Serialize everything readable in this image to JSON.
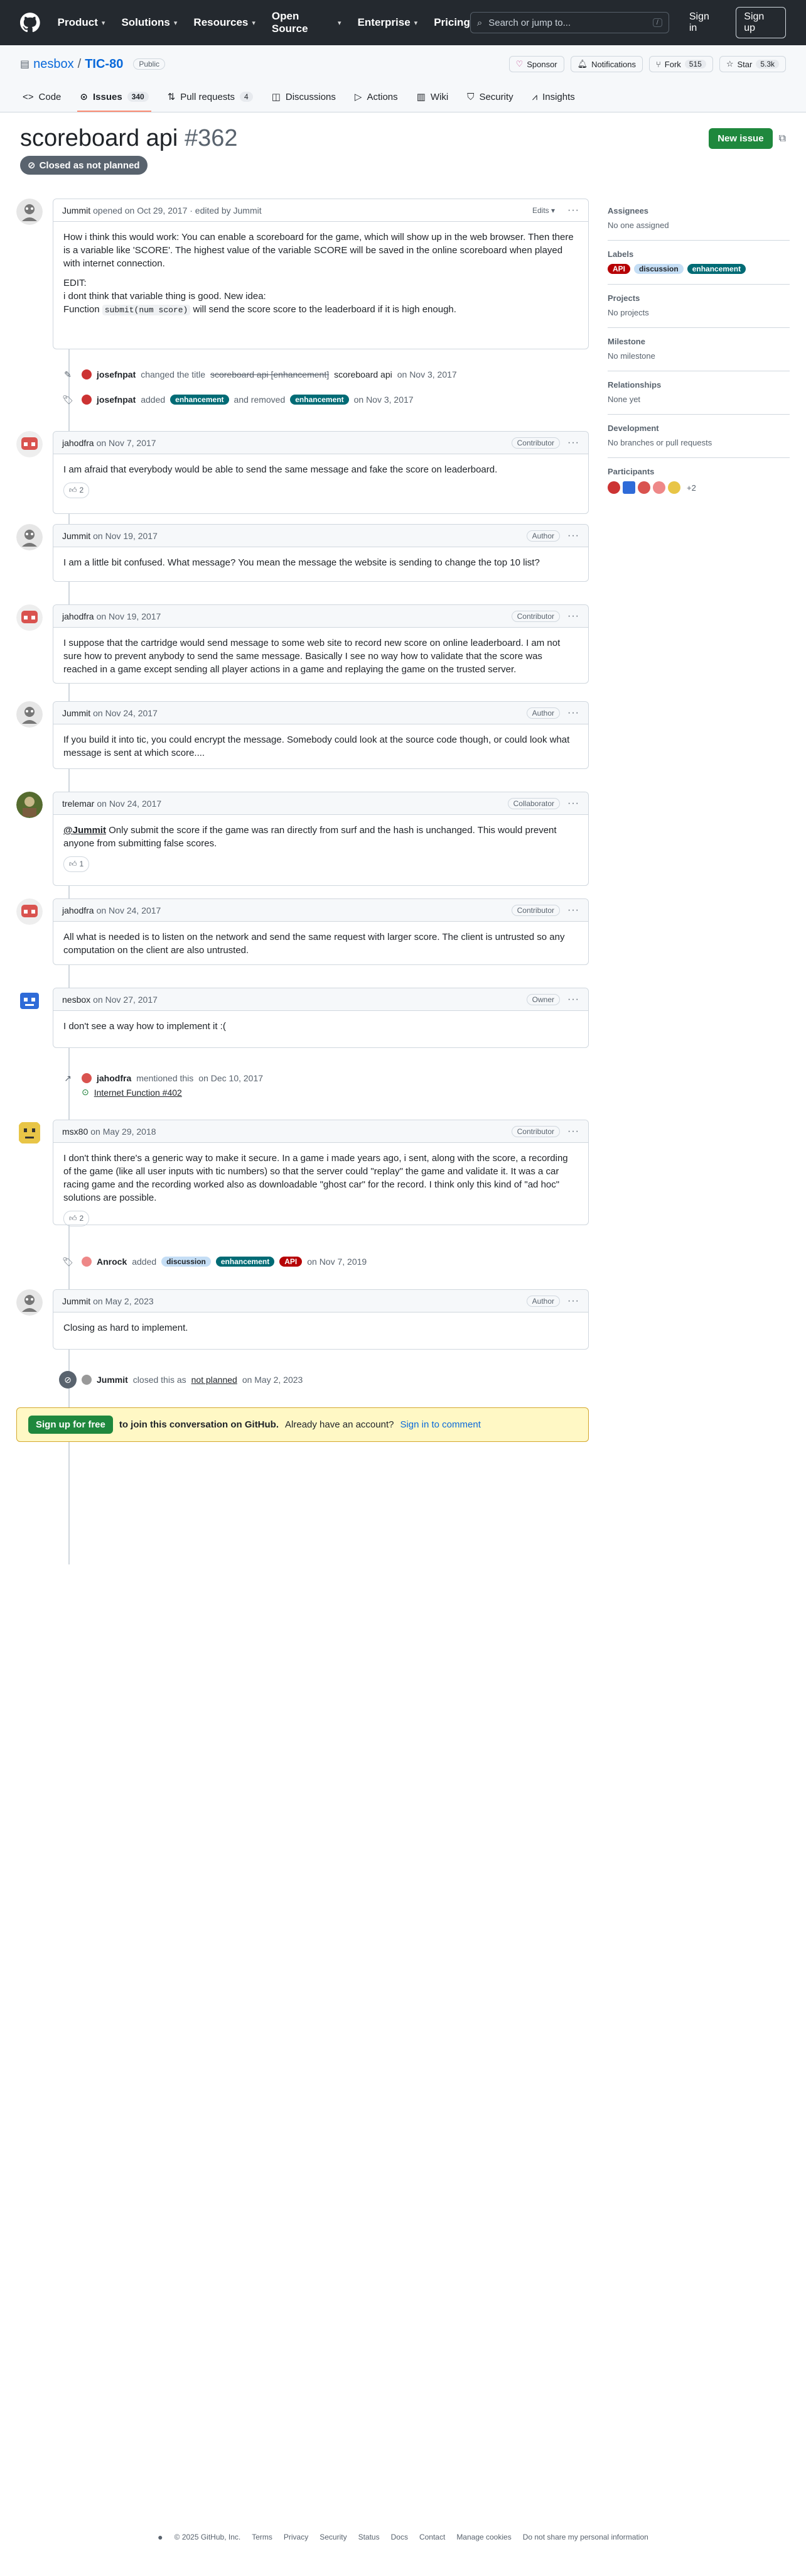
{
  "header": {
    "nav": [
      "Product",
      "Solutions",
      "Resources",
      "Open Source",
      "Enterprise",
      "Pricing"
    ],
    "search_placeholder": "Search or jump to...",
    "search_kbd": "/",
    "signin": "Sign in",
    "signup": "Sign up"
  },
  "repo": {
    "owner": "nesbox",
    "name": "TIC-80",
    "visibility": "Public",
    "sponsor": "Sponsor",
    "notifications": "Notifications",
    "fork_label": "Fork",
    "fork_count": "515",
    "star_label": "Star",
    "star_count": "5.3k",
    "tabs": [
      {
        "label": "Code",
        "count": ""
      },
      {
        "label": "Issues",
        "count": "340"
      },
      {
        "label": "Pull requests",
        "count": "4"
      },
      {
        "label": "Discussions",
        "count": ""
      },
      {
        "label": "Actions",
        "count": ""
      },
      {
        "label": "Wiki",
        "count": ""
      },
      {
        "label": "Security",
        "count": ""
      },
      {
        "label": "Insights",
        "count": ""
      }
    ]
  },
  "issue": {
    "title": "scoreboard api",
    "number": "#362",
    "state": "Closed as not planned",
    "new_issue": "New issue"
  },
  "comments": [
    {
      "author": "Jummit",
      "date_text": "opened on Oct 29, 2017",
      "edited": "· edited by Jummit",
      "edits": "Edits",
      "body": [
        "How i think this would work: You can enable a scoreboard for the game, which will show up in the web browser. Then there is a variable like 'SCORE'. The highest value of the variable SCORE will be saved in the online scoreboard when played with internet connection.",
        "EDIT:",
        "i dont think that variable thing is good. New idea:",
        "Function",
        "submit(num score)",
        "will send the score score to the leaderboard if it is high enough."
      ]
    },
    {
      "author": "jahodfra",
      "date": "on Nov 7, 2017",
      "role": "Contributor",
      "body": "I am afraid that everybody would be able to send the same message and fake the score on leaderboard.",
      "reaction": "2"
    },
    {
      "author": "Jummit",
      "date": "on Nov 19, 2017",
      "role": "Author",
      "body": "I am a little bit confused. What message? You mean the message the website is sending to change the top 10 list?"
    },
    {
      "author": "jahodfra",
      "date": "on Nov 19, 2017",
      "role": "Contributor",
      "body": "I suppose that the cartridge would send message to some web site to record new score on online leaderboard. I am not sure how to prevent anybody to send the same message. Basically I see no way how to validate that the score was reached in a game except sending all player actions in a game and replaying the game on the trusted server."
    },
    {
      "author": "Jummit",
      "date": "on Nov 24, 2017",
      "role": "Author",
      "body": "If you build it into tic, you could encrypt the message. Somebody could look at the source code though, or could look what message is sent at which score...."
    },
    {
      "author": "trelemar",
      "date": "on Nov 24, 2017",
      "role": "Collaborator",
      "mention": "@Jummit",
      "body": "Only submit the score if the game was ran directly from surf and the hash is unchanged. This would prevent anyone from submitting false scores.",
      "reaction": "1"
    },
    {
      "author": "jahodfra",
      "date": "on Nov 24, 2017",
      "role": "Contributor",
      "body": "All what is needed is to listen on the network and send the same request with larger score. The client is untrusted so any computation on the client are also untrusted."
    },
    {
      "author": "nesbox",
      "date": "on Nov 27, 2017",
      "role": "Owner",
      "body": "I don't see a way how to implement it :("
    },
    {
      "author": "msx80",
      "date": "on May 29, 2018",
      "role": "Contributor",
      "body": "I don't think there's a generic way to make it secure. In a game i made years ago, i sent, along with the score, a recording of the game (like all user inputs with tic numbers) so that the server could \"replay\" the game and validate it. It was a car racing game and the recording worked also as downloadable \"ghost car\" for the record. I think only this kind of \"ad hoc\" solutions are possible.",
      "reaction": "2"
    },
    {
      "author": "Jummit",
      "date": "on May 2, 2023",
      "role": "Author",
      "body": "Closing as hard to implement."
    }
  ],
  "events": {
    "rename": {
      "actor": "josefnpat",
      "text1": "changed the title",
      "old": "scoreboard api [enhancement]",
      "new": "scoreboard api",
      "date": "on Nov 3, 2017"
    },
    "relabel": {
      "actor": "josefnpat",
      "added": "added",
      "removed": "and removed",
      "label": "enhancement",
      "date": "on Nov 3, 2017"
    },
    "mention": {
      "actor": "jahodfra",
      "text": "mentioned this",
      "date": "on Dec 10, 2017",
      "ref": "Internet Function #402"
    },
    "labels": {
      "actor": "Anrock",
      "added": "added",
      "date": "on Nov 7, 2019"
    },
    "closed": {
      "actor": "Jummit",
      "text": "closed this as",
      "reason": "not planned",
      "date": "on May 2, 2023"
    }
  },
  "labels": {
    "api": "API",
    "discussion": "discussion",
    "enhancement": "enhancement"
  },
  "join": {
    "button": "Sign up for free",
    "text": "to join this conversation on GitHub.",
    "already": "Already have an account?",
    "signin": "Sign in to comment"
  },
  "sidebar": {
    "assignees_title": "Assignees",
    "assignees_value": "No one assigned",
    "labels_title": "Labels",
    "projects_title": "Projects",
    "projects_value": "No projects",
    "milestone_title": "Milestone",
    "milestone_value": "No milestone",
    "relationships_title": "Relationships",
    "relationships_value": "None yet",
    "development_title": "Development",
    "development_value": "No branches or pull requests",
    "participants_title": "Participants",
    "participants_more": "+2"
  },
  "footer": {
    "copyright": "© 2025 GitHub, Inc.",
    "links": [
      "Terms",
      "Privacy",
      "Security",
      "Status",
      "Docs",
      "Contact",
      "Manage cookies",
      "Do not share my personal information"
    ]
  }
}
